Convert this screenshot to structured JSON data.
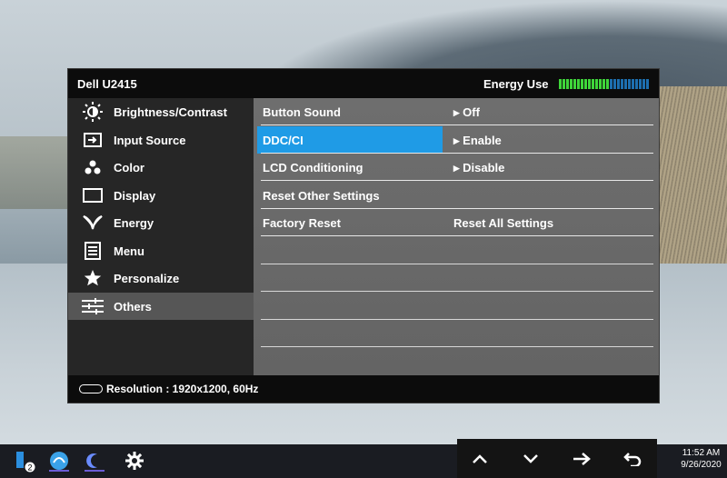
{
  "osd": {
    "model": "Dell U2415",
    "energy_label": "Energy Use",
    "energy_level_fraction": 0.55,
    "sidebar": [
      {
        "label": "Brightness/Contrast",
        "icon": "brightness-icon"
      },
      {
        "label": "Input Source",
        "icon": "input-source-icon"
      },
      {
        "label": "Color",
        "icon": "color-icon"
      },
      {
        "label": "Display",
        "icon": "display-icon"
      },
      {
        "label": "Energy",
        "icon": "energy-icon"
      },
      {
        "label": "Menu",
        "icon": "menu-icon"
      },
      {
        "label": "Personalize",
        "icon": "star-icon"
      },
      {
        "label": "Others",
        "icon": "sliders-icon",
        "active": true
      }
    ],
    "settings": [
      {
        "label": "Button Sound",
        "value": "Off",
        "arrow": "▸"
      },
      {
        "label": "DDC/CI",
        "value": "Enable",
        "arrow": "▸",
        "selected": true
      },
      {
        "label": "LCD Conditioning",
        "value": "Disable",
        "arrow": "▸"
      },
      {
        "label": "Reset Other Settings",
        "value": "",
        "arrow": ""
      },
      {
        "label": "Factory Reset",
        "value": "Reset All Settings",
        "arrow": ""
      }
    ],
    "footer": "Resolution : 1920x1200, 60Hz"
  },
  "taskbar": {
    "badge": "2",
    "clock_time": "11:52 AM",
    "clock_date": "9/26/2020"
  },
  "colors": {
    "accent": "#1f9be6",
    "energy_on": "#3fd63a",
    "energy_off": "#1d6fb0"
  }
}
